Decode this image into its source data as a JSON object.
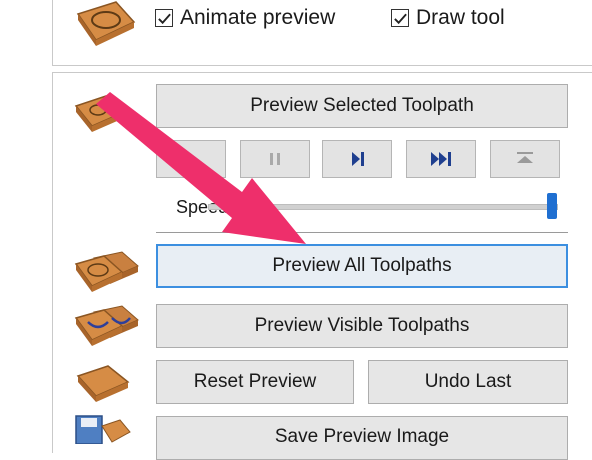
{
  "options": {
    "animate_preview": {
      "label": "Animate preview",
      "checked": true
    },
    "draw_tool": {
      "label": "Draw tool",
      "checked": true
    }
  },
  "buttons": {
    "preview_selected": "Preview Selected Toolpath",
    "preview_all": "Preview All Toolpaths",
    "preview_visible": "Preview Visible Toolpaths",
    "reset_preview": "Reset Preview",
    "undo_last": "Undo Last",
    "save_preview_image": "Save Preview Image"
  },
  "playback": {
    "controls": [
      "play-icon",
      "pause-icon",
      "step-icon",
      "fast-forward-icon",
      "eject-icon"
    ],
    "speed_label": "Speed",
    "speed_value": 1.0
  },
  "colors": {
    "accent_arrow": "#ee2f6b",
    "focus_border": "#3c8fe0",
    "slider_thumb": "#1f6fd1",
    "control_icon": "#1f3f8f",
    "tool_wood": "#d68c45"
  }
}
